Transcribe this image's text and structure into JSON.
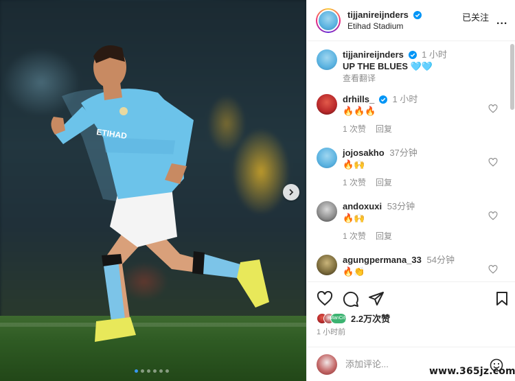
{
  "post": {
    "carousel_dots": 6,
    "active_dot": 0
  },
  "header": {
    "username": "tijjanireijnders",
    "location": "Etihad Stadium",
    "follow_status": "已关注",
    "more": "..."
  },
  "caption": {
    "username": "tijjanireijnders",
    "time": "1 小时",
    "text": "UP THE BLUES 🩵🩵",
    "translate": "查看翻译"
  },
  "comments": [
    {
      "username": "drhills_",
      "verified": true,
      "time": "1 小时",
      "text": "🔥🔥🔥",
      "likes": "1 次赞",
      "reply": "回复"
    },
    {
      "username": "jojosakho",
      "verified": false,
      "time": "37分钟",
      "text": "🔥🙌",
      "likes": "1 次赞",
      "reply": "回复"
    },
    {
      "username": "andoxuxi",
      "verified": false,
      "time": "53分钟",
      "text": "🔥🙌",
      "likes": "1 次赞",
      "reply": "回复"
    },
    {
      "username": "agungpermana_33",
      "verified": false,
      "time": "54分钟",
      "text": "🔥👏",
      "likes": "",
      "reply": ""
    }
  ],
  "actions": {
    "likes": "2.2万次赞",
    "liker_tag": "ManCity",
    "post_time": "1 小时前"
  },
  "compose": {
    "placeholder": "添加评论..."
  },
  "watermark": "www.365jz.com",
  "colors": {
    "verified": "#0095f6",
    "secondary_text": "#8e8e8e",
    "city_blue": "#6cabdd"
  }
}
